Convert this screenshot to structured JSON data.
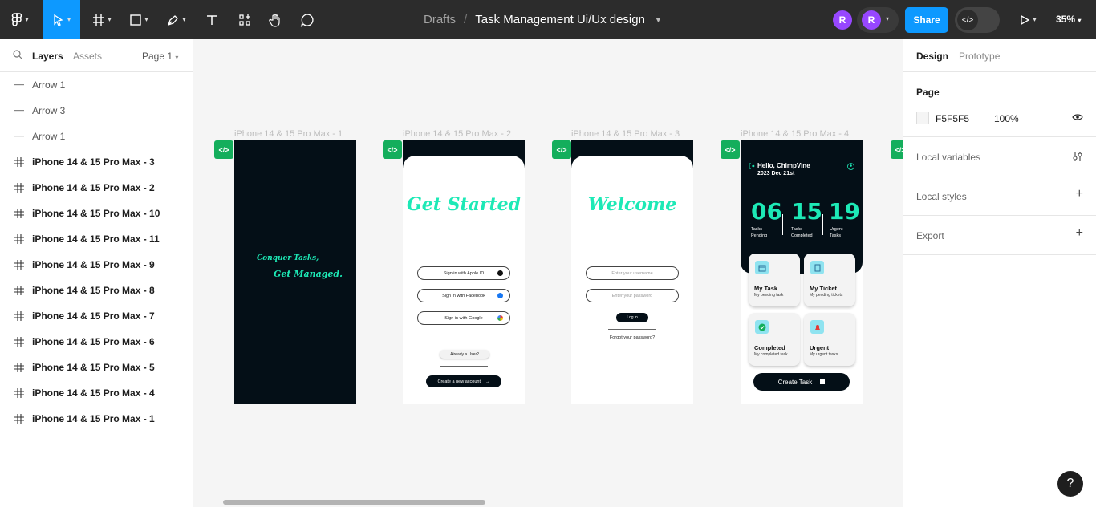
{
  "toolbar": {
    "breadcrumb_parent": "Drafts",
    "breadcrumb_sep": "/",
    "file_name": "Task Management Ui/Ux design",
    "avatar1": "R",
    "avatar2": "R",
    "share_label": "Share",
    "zoom": "35%",
    "accent": "#0d99ff"
  },
  "left_panel": {
    "tab_layers": "Layers",
    "tab_assets": "Assets",
    "page_select": "Page 1",
    "layers": [
      {
        "name": "Arrow 1",
        "type": "arrow"
      },
      {
        "name": "Arrow 3",
        "type": "arrow"
      },
      {
        "name": "Arrow 1",
        "type": "arrow"
      },
      {
        "name": "iPhone 14 & 15 Pro Max - 3",
        "type": "frame"
      },
      {
        "name": "iPhone 14 & 15 Pro Max - 2",
        "type": "frame"
      },
      {
        "name": "iPhone 14 & 15 Pro Max - 10",
        "type": "frame"
      },
      {
        "name": "iPhone 14 & 15 Pro Max - 11",
        "type": "frame"
      },
      {
        "name": "iPhone 14 & 15 Pro Max - 9",
        "type": "frame"
      },
      {
        "name": "iPhone 14 & 15 Pro Max - 8",
        "type": "frame"
      },
      {
        "name": "iPhone 14 & 15 Pro Max - 7",
        "type": "frame"
      },
      {
        "name": "iPhone 14 & 15 Pro Max - 6",
        "type": "frame"
      },
      {
        "name": "iPhone 14 & 15 Pro Max - 5",
        "type": "frame"
      },
      {
        "name": "iPhone 14 & 15 Pro Max - 4",
        "type": "frame"
      },
      {
        "name": "iPhone 14 & 15 Pro Max - 1",
        "type": "frame"
      }
    ]
  },
  "right_panel": {
    "tab_design": "Design",
    "tab_prototype": "Prototype",
    "page_title": "Page",
    "page_color": "F5F5F5",
    "page_opacity": "100%",
    "local_variables": "Local variables",
    "local_styles": "Local styles",
    "export": "Export"
  },
  "canvas": {
    "frame_labels": [
      "iPhone 14 & 15 Pro Max - 1",
      "iPhone 14 & 15 Pro Max - 2",
      "iPhone 14 & 15 Pro Max - 3",
      "iPhone 14 & 15 Pro Max - 4"
    ],
    "code_badge": "</>",
    "phone1": {
      "line1": "Conquer Tasks,",
      "line2": "Get Managed."
    },
    "phone2": {
      "title": "Get Started",
      "apple": "Sign in with Apple ID",
      "facebook": "Sign in with Facebook",
      "google": "Sign in with Google",
      "already": "Already a User?",
      "create": "Create a new account"
    },
    "phone3": {
      "title": "Welcome",
      "username_placeholder": "Enter your username",
      "password_placeholder": "Enter your password",
      "login": "Log in",
      "forgot": "Forgot your password?"
    },
    "phone4": {
      "hello": "Hello, ChimpVine",
      "date": "2023 Dec 21st",
      "stats": [
        {
          "value": "06",
          "label1": "Tasks",
          "label2": "Pending"
        },
        {
          "value": "15",
          "label1": "Tasks",
          "label2": "Completed"
        },
        {
          "value": "19",
          "label1": "Urgent",
          "label2": "Tasks"
        }
      ],
      "cards": [
        {
          "title": "My Task",
          "sub": "My pending task"
        },
        {
          "title": "My Ticket",
          "sub": "My pending tickets"
        },
        {
          "title": "Completed",
          "sub": "My completed task"
        },
        {
          "title": "Urgent",
          "sub": "My urgent tasks"
        }
      ],
      "create_task": "Create Task",
      "accent": "#1de9b6"
    }
  },
  "help": "?"
}
